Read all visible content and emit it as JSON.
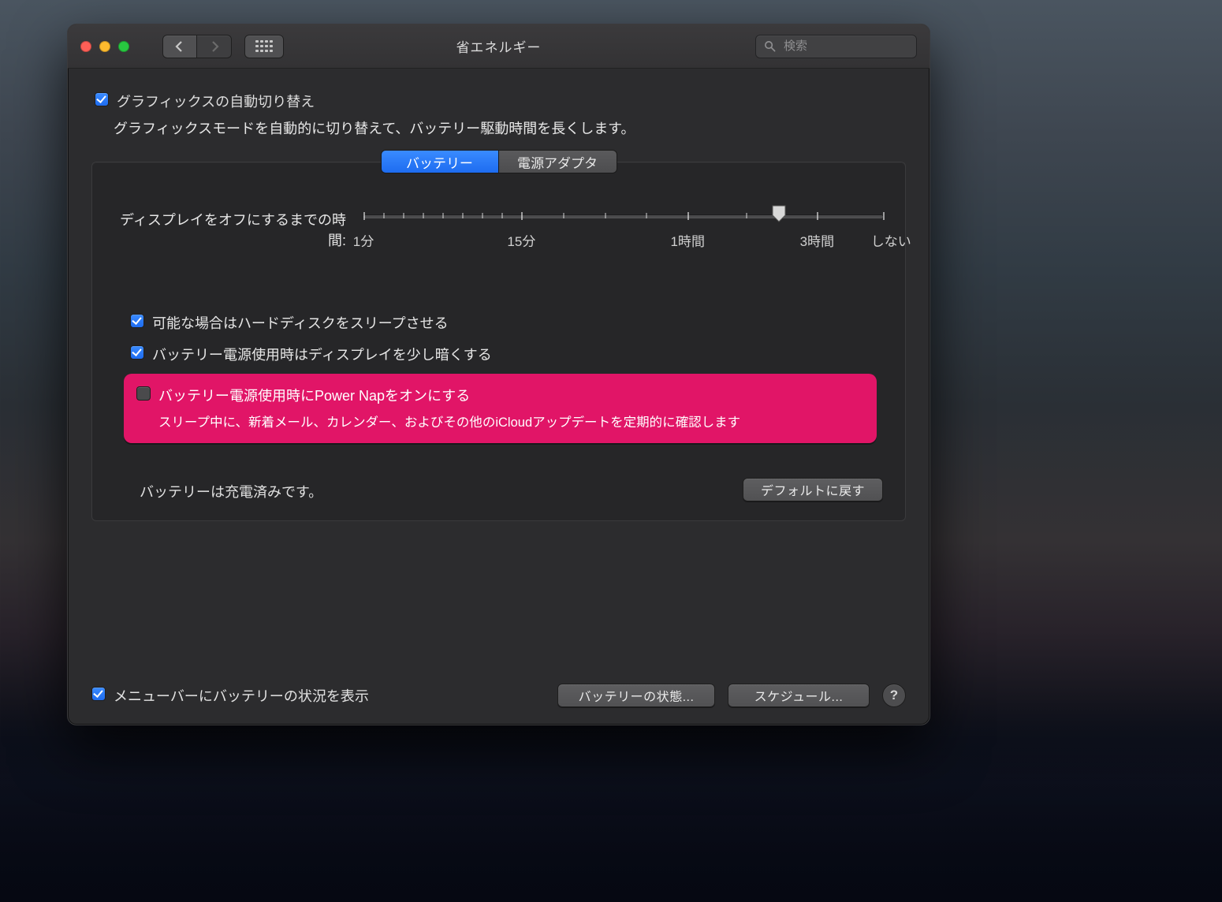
{
  "window": {
    "title": "省エネルギー"
  },
  "search": {
    "placeholder": "検索"
  },
  "graphics": {
    "label": "グラフィックスの自動切り替え",
    "desc": "グラフィックスモードを自動的に切り替えて、バッテリー駆動時間を長くします。"
  },
  "tabs": {
    "battery": "バッテリー",
    "adapter": "電源アダプタ"
  },
  "slider": {
    "label": "ディスプレイをオフにするまでの時間:",
    "ticks": [
      "1分",
      "15分",
      "1時間",
      "3時間",
      "しない"
    ]
  },
  "options": {
    "hdd_sleep": "可能な場合はハードディスクをスリープさせる",
    "dim_display": "バッテリー電源使用時はディスプレイを少し暗くする",
    "power_nap": "バッテリー電源使用時にPower Napをオンにする",
    "power_nap_desc": "スリープ中に、新着メール、カレンダー、およびその他のiCloudアップデートを定期的に確認します"
  },
  "status": "バッテリーは充電済みです。",
  "buttons": {
    "restore_defaults": "デフォルトに戻す",
    "battery_status": "バッテリーの状態...",
    "schedule": "スケジュール..."
  },
  "menubar": {
    "show_battery": "メニューバーにバッテリーの状況を表示"
  }
}
